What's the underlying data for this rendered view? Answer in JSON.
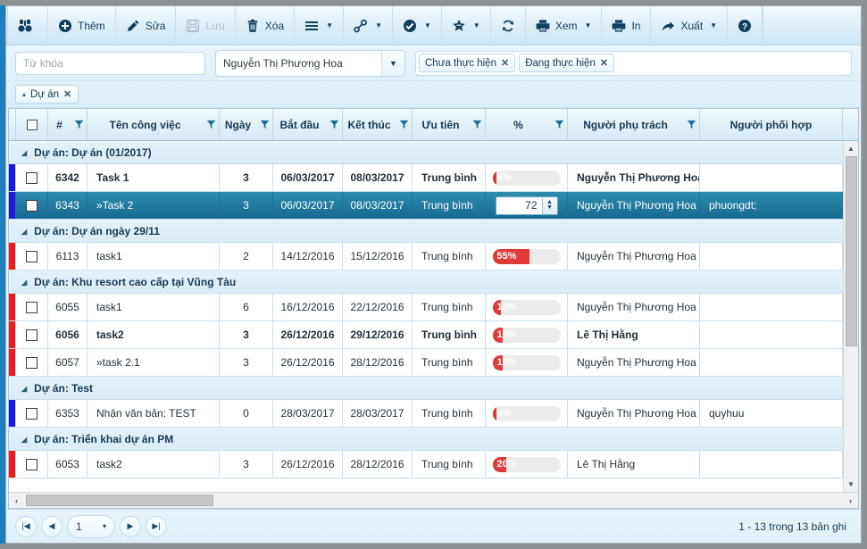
{
  "toolbar": {
    "items": [
      {
        "name": "binoculars",
        "icon": "binoculars-icon",
        "label": "",
        "caret": false,
        "disabled": false
      },
      {
        "name": "add",
        "icon": "plus-circle-icon",
        "label": "Thêm",
        "caret": false,
        "disabled": false
      },
      {
        "name": "edit",
        "icon": "pencil-icon",
        "label": "Sửa",
        "caret": false,
        "disabled": false
      },
      {
        "name": "save",
        "icon": "floppy-disk-icon",
        "label": "Lưu",
        "caret": false,
        "disabled": true
      },
      {
        "name": "delete",
        "icon": "trash-icon",
        "label": "Xóa",
        "caret": false,
        "disabled": false
      },
      {
        "name": "list-menu",
        "icon": "hamburger-icon",
        "label": "",
        "caret": true,
        "disabled": false
      },
      {
        "name": "link-menu",
        "icon": "link-icon",
        "label": "",
        "caret": true,
        "disabled": false
      },
      {
        "name": "approve-menu",
        "icon": "check-circle-icon",
        "label": "",
        "caret": true,
        "disabled": false
      },
      {
        "name": "favorite-menu",
        "icon": "star-icon",
        "label": "",
        "caret": true,
        "disabled": false
      },
      {
        "name": "refresh",
        "icon": "refresh-icon",
        "label": "",
        "caret": false,
        "disabled": false
      },
      {
        "name": "view-menu",
        "icon": "printer-icon",
        "label": "Xem",
        "caret": true,
        "disabled": false
      },
      {
        "name": "print",
        "icon": "printer-icon",
        "label": "In",
        "caret": false,
        "disabled": false
      },
      {
        "name": "export-menu",
        "icon": "export-arrow-icon",
        "label": "Xuất",
        "caret": true,
        "disabled": false
      },
      {
        "name": "help",
        "icon": "question-circle-icon",
        "label": "",
        "caret": false,
        "disabled": false
      }
    ]
  },
  "searchbar": {
    "keyword_placeholder": "Từ khóa",
    "keyword_value": "",
    "person_selected": "Nguyễn Thị Phương Hoa",
    "status_tags": [
      "Chưa thực hiện",
      "Đang thực hiện"
    ],
    "tag_close_glyph": "✕"
  },
  "grouptab": {
    "label": "Dự án",
    "collapse_glyph": "▴",
    "close_glyph": "✕"
  },
  "grid": {
    "columns": [
      {
        "key": "chk",
        "label": "",
        "filter": false
      },
      {
        "key": "id",
        "label": "#",
        "filter": true
      },
      {
        "key": "name",
        "label": "Tên công việc",
        "filter": true
      },
      {
        "key": "days",
        "label": "Ngày",
        "filter": true
      },
      {
        "key": "start",
        "label": "Bắt đầu",
        "filter": true
      },
      {
        "key": "end",
        "label": "Kết thúc",
        "filter": true
      },
      {
        "key": "prio",
        "label": "Ưu tiên",
        "filter": true
      },
      {
        "key": "pct",
        "label": "%",
        "filter": true
      },
      {
        "key": "resp",
        "label": "Người phụ trách",
        "filter": true
      },
      {
        "key": "coop",
        "label": "Người phối hợp",
        "filter": false
      }
    ],
    "groups": [
      {
        "title": "Dự án: Dự án (01/2017)",
        "rows": [
          {
            "grip": "blue",
            "id": "6342",
            "name": "Task 1",
            "bold": true,
            "days": "3",
            "start": "06/03/2017",
            "end": "08/03/2017",
            "prio": "Trung bình",
            "pct": 6,
            "pct_label": "6%",
            "editor": false,
            "resp": "Nguyễn Thị Phương Hoa",
            "coop": "",
            "selected": false
          },
          {
            "grip": "blue",
            "id": "6343",
            "name": "»Task 2",
            "bold": false,
            "days": "3",
            "start": "06/03/2017",
            "end": "08/03/2017",
            "prio": "Trung bình",
            "pct": 72,
            "pct_label": "72",
            "editor": true,
            "resp": "Nguyễn Thị Phương Hoa",
            "coop": "phuongdt;",
            "selected": true
          }
        ]
      },
      {
        "title": "Dự án: Dự án ngày 29/11",
        "rows": [
          {
            "grip": "red",
            "id": "6113",
            "name": "task1",
            "bold": false,
            "days": "2",
            "start": "14/12/2016",
            "end": "15/12/2016",
            "prio": "Trung bình",
            "pct": 55,
            "pct_label": "55%",
            "editor": false,
            "resp": "Nguyễn Thị Phương Hoa",
            "coop": "",
            "selected": false
          }
        ]
      },
      {
        "title": "Dự án: Khu resort cao cấp tại Vũng Tàu",
        "rows": [
          {
            "grip": "red",
            "id": "6055",
            "name": "task1",
            "bold": false,
            "days": "6",
            "start": "16/12/2016",
            "end": "22/12/2016",
            "prio": "Trung bình",
            "pct": 13,
            "pct_label": "13%",
            "editor": false,
            "resp": "Nguyễn Thị Phương Hoa",
            "coop": "",
            "selected": false
          },
          {
            "grip": "red",
            "id": "6056",
            "name": "task2",
            "bold": true,
            "days": "3",
            "start": "26/12/2016",
            "end": "29/12/2016",
            "prio": "Trung bình",
            "pct": 15,
            "pct_label": "15%",
            "editor": false,
            "resp": "Lê Thị Hằng",
            "coop": "",
            "selected": false
          },
          {
            "grip": "red",
            "id": "6057",
            "name": "»task 2.1",
            "bold": false,
            "days": "3",
            "start": "26/12/2016",
            "end": "28/12/2016",
            "prio": "Trung bình",
            "pct": 15,
            "pct_label": "15%",
            "editor": false,
            "resp": "Nguyễn Thị Phương Hoa",
            "coop": "",
            "selected": false
          }
        ]
      },
      {
        "title": "Dự án: Test",
        "rows": [
          {
            "grip": "blue",
            "id": "6353",
            "name": "Nhận văn bản: TEST",
            "bold": false,
            "days": "0",
            "start": "28/03/2017",
            "end": "28/03/2017",
            "prio": "Trung bình",
            "pct": 6,
            "pct_label": "6%",
            "editor": false,
            "resp": "Nguyễn Thị Phương Hoa",
            "coop": "quyhuu",
            "selected": false
          }
        ]
      },
      {
        "title": "Dự án: Triển khai dự án PM",
        "rows": [
          {
            "grip": "red",
            "id": "6053",
            "name": "task2",
            "bold": false,
            "days": "3",
            "start": "26/12/2016",
            "end": "28/12/2016",
            "prio": "Trung bình",
            "pct": 20,
            "pct_label": "20%",
            "editor": false,
            "resp": "Lê Thị Hằng",
            "coop": "",
            "selected": false
          }
        ]
      }
    ],
    "group_collapse_glyph": "◢",
    "progress_color": "#e03b3b"
  },
  "footer": {
    "first_glyph": "|◀",
    "prev_glyph": "◀",
    "page_value": "1",
    "page_caret": "▾",
    "next_glyph": "▶",
    "last_glyph": "▶|",
    "info": "1 - 13 trong 13 bản ghi"
  }
}
